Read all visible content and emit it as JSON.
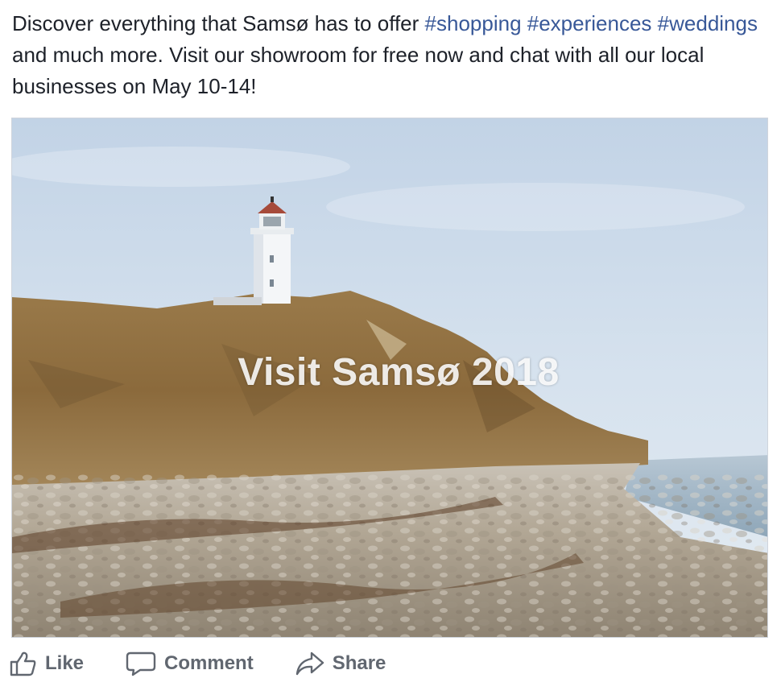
{
  "post": {
    "text_part1": "Discover everything that Samsø has to offer ",
    "hashtags": [
      "#shopping",
      "#experiences",
      "#weddings"
    ],
    "text_part2": " and much more. Visit our showroom for free now and chat with all our local businesses on May 10-14!"
  },
  "photo": {
    "overlay_text": "Visit Samsø 2018",
    "icon": "lighthouse-beach-photo"
  },
  "actions": {
    "like_label": "Like",
    "comment_label": "Comment",
    "share_label": "Share",
    "like_icon": "thumbs-up-icon",
    "comment_icon": "speech-bubble-icon",
    "share_icon": "share-arrow-icon"
  },
  "colors": {
    "text": "#1d2129",
    "hashtag": "#385898",
    "action_text": "#616770"
  }
}
